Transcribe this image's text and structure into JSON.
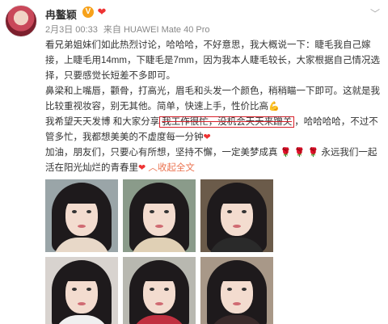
{
  "user": {
    "name": "冉鳌颖",
    "verified_icon": "v-badge-icon",
    "badge_icon": "heart-badge-icon"
  },
  "meta": {
    "date": "2月3日 00:33",
    "source": "来自 HUAWEI Mate 40 Pro"
  },
  "post": {
    "p1": "看兄弟姐妹们如此热烈讨论，哈哈哈，不好意思，我大概说一下：睫毛我自己嫁接，上睫毛用14mm，下睫毛是7mm，因为我本人睫毛较长，大家根据自己情况选择，只要感觉长短差不多即可。",
    "p2": "鼻梁和上嘴唇，颧骨，打高光，眉毛和头发一个颜色，稍稍瞄一下即可。这就是我比较重视妆容，别无其他。简单，快速上手，性价比高",
    "p3a": "我希望天天发博 和大家分享",
    "p3_highlight": "我工作很忙，没机会天天来蹭关",
    "p3b": "，哈哈哈哈，不过不管多忙，我都想美美的不虚度每一分钟",
    "p4a": "加油，朋友们，只要心有所想，坚持不懈，一定美梦成真",
    "p4b": "永远我们一起活在阳光灿烂的青春里",
    "expand_label": "收起全文",
    "expand_icon": "chevron-up-icon"
  },
  "photos": [
    {
      "caption": ""
    },
    {
      "caption": ""
    },
    {
      "caption": ""
    },
    {
      "caption": ""
    },
    {
      "caption": ""
    },
    {
      "caption": ""
    }
  ]
}
